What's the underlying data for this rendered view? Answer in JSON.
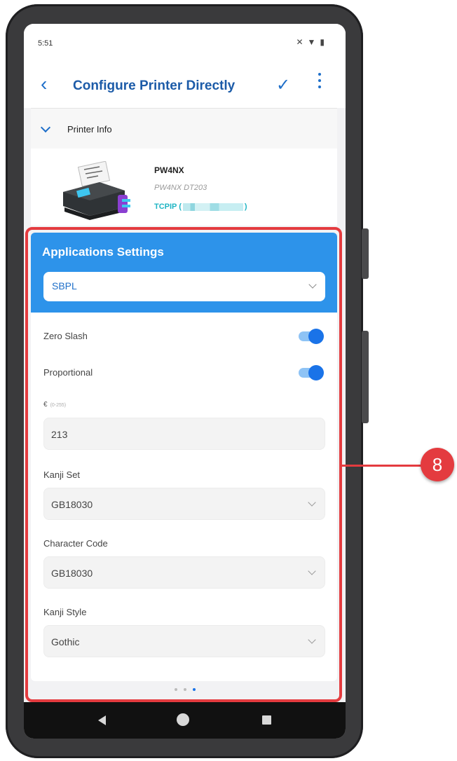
{
  "status": {
    "time": "5:51"
  },
  "appbar": {
    "title": "Configure Printer Directly"
  },
  "printer_info": {
    "section_label": "Printer Info",
    "model": "PW4NX",
    "subtitle": "PW4NX DT203",
    "connection_prefix": "TCPIP (",
    "connection_suffix": ")"
  },
  "app_settings": {
    "title": "Applications Settings",
    "language": "SBPL",
    "zero_slash": {
      "label": "Zero Slash",
      "on": true
    },
    "proportional": {
      "label": "Proportional",
      "on": true
    },
    "euro": {
      "label": "€",
      "range": "(0-255)",
      "value": "213"
    },
    "kanji_set": {
      "label": "Kanji Set",
      "value": "GB18030"
    },
    "character_code": {
      "label": "Character Code",
      "value": "GB18030"
    },
    "kanji_style": {
      "label": "Kanji Style",
      "value": "Gothic"
    }
  },
  "pager": {
    "count": 3,
    "active": 3
  },
  "callout": {
    "number": "8"
  },
  "colors": {
    "accent": "#2d93ea",
    "highlight": "#e43b3f",
    "connection": "#1fb5c4"
  }
}
